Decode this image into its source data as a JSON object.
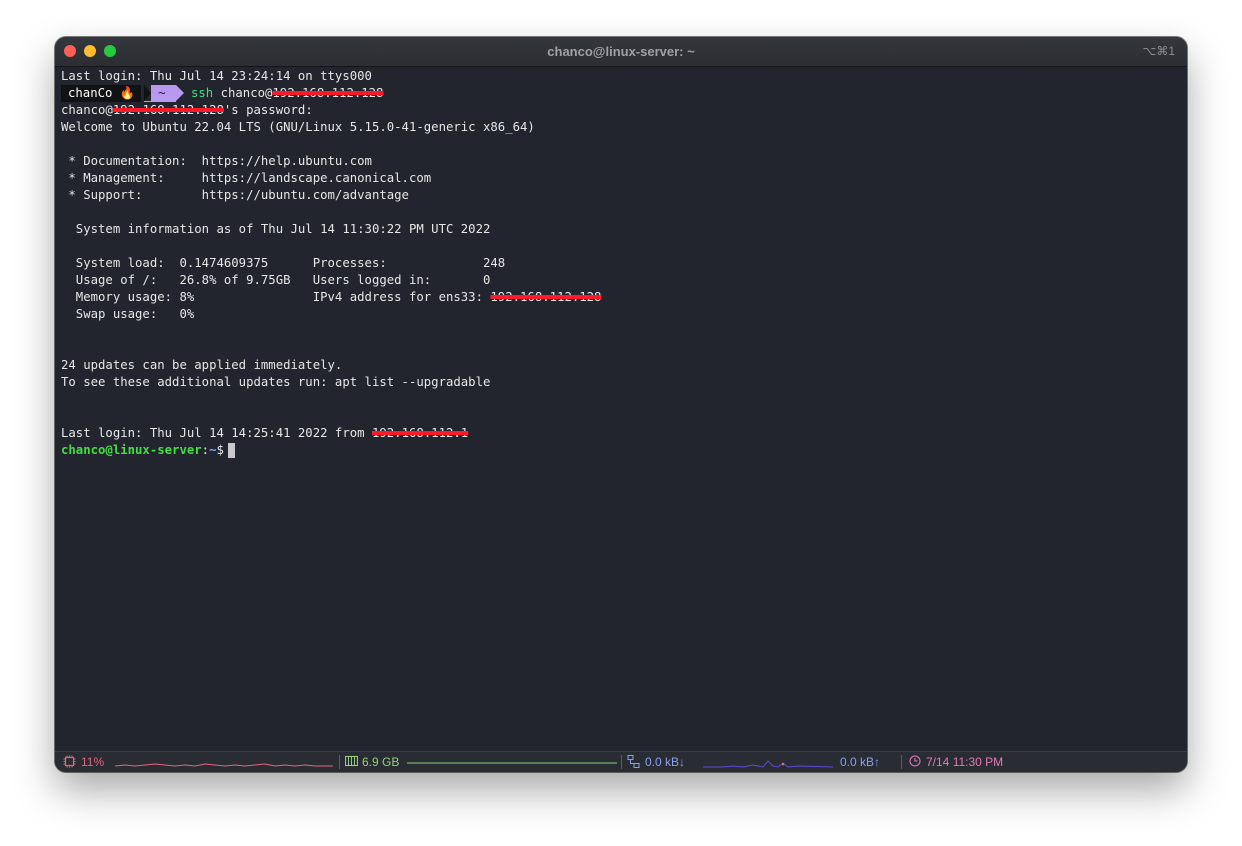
{
  "window": {
    "title": "chanco@linux-server: ~",
    "shortcut": "⌥⌘1"
  },
  "terminal": {
    "last_login_local": "Last login: Thu Jul 14 23:24:14 on ttys000",
    "prompt": {
      "user": "chanCo 🔥",
      "dir": "~",
      "command": "ssh",
      "args_prefix": " chanco@",
      "redacted_ip": "192.168.112.128"
    },
    "password_prefix": "chanco@",
    "password_redacted": "192.168.112.128",
    "password_suffix": "'s password:",
    "welcome": "Welcome to Ubuntu 22.04 LTS (GNU/Linux 5.15.0-41-generic x86_64)",
    "links": [
      " * Documentation:  https://help.ubuntu.com",
      " * Management:     https://landscape.canonical.com",
      " * Support:        https://ubuntu.com/advantage"
    ],
    "sysinfo_header": "  System information as of Thu Jul 14 11:30:22 PM UTC 2022",
    "sysinfo": [
      "  System load:  0.1474609375      Processes:             248",
      "  Usage of /:   26.8% of 9.75GB   Users logged in:       0"
    ],
    "memory_line_prefix": "  Memory usage: 8%                IPv4 address for ens33: ",
    "memory_line_redacted": "192.168.112.128",
    "swap_line": "  Swap usage:   0%",
    "updates_1": "24 updates can be applied immediately.",
    "updates_2": "To see these additional updates run: apt list --upgradable",
    "last_login_remote_prefix": "Last login: Thu Jul 14 14:25:41 2022 from ",
    "last_login_remote_redacted": "192.168.112.1",
    "final_prompt": {
      "user_host": "chanco@linux-server",
      "colon": ":",
      "path": "~",
      "symbol": "$"
    }
  },
  "statusbar": {
    "cpu": "11%",
    "memory": "6.9 GB",
    "net_down": "0.0 kB↓",
    "net_up": "0.0 kB↑",
    "clock": "7/14 11:30 PM",
    "colors": {
      "cpu": "#e0677a",
      "memory": "#8fd07a",
      "network": "#8a9ff0",
      "clock": "#e07ab4"
    }
  }
}
